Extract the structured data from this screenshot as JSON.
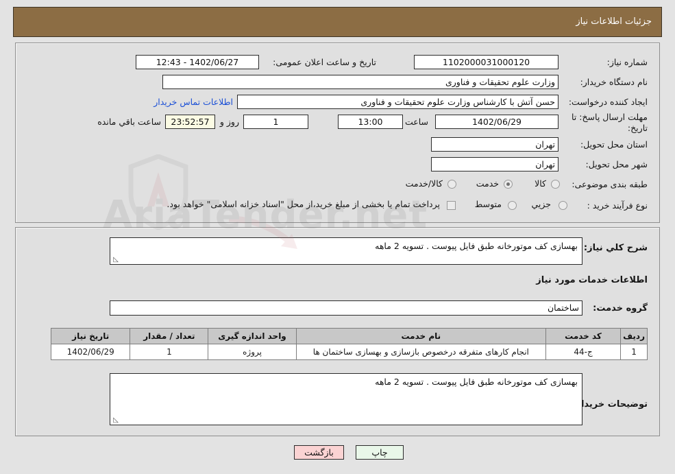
{
  "header": {
    "title": "جزئیات اطلاعات نیاز"
  },
  "watermark": {
    "text": "AriaTender.net"
  },
  "form": {
    "need_number_label": "شماره نیاز:",
    "need_number_value": "1102000031000120",
    "announce_datetime_label": "تاریخ و ساعت اعلان عمومی:",
    "announce_datetime_value": "1402/06/27 - 12:43",
    "buyer_org_label": "نام دستگاه خریدار:",
    "buyer_org_value": "وزارت علوم  تحقیقات و فناوری",
    "request_creator_label": "ایجاد کننده درخواست:",
    "request_creator_value": "حسن آتش با کارشناس وزارت علوم  تحقیقات و فناوری",
    "contact_link": "اطلاعات تماس خریدار",
    "deadline_label": "مهلت ارسال پاسخ: تا تاریخ:",
    "deadline_date": "1402/06/29",
    "time_label": "ساعت",
    "time_value": "13:00",
    "days_value": "1",
    "days_label": "روز و",
    "countdown_value": "23:52:57",
    "countdown_label": "ساعت باقي مانده",
    "province_label": "استان محل تحویل:",
    "province_value": "تهران",
    "city_label": "شهر محل تحویل:",
    "city_value": "تهران",
    "category_label": "طبقه بندی موضوعی:",
    "category_options": [
      "کالا",
      "خدمت",
      "کالا/خدمت"
    ],
    "category_selected": "خدمت",
    "process_label": "نوع فرآیند خرید :",
    "process_options": [
      "جزیي",
      "متوسط"
    ],
    "process_selected": "جزیي",
    "treasury_note": "پرداخت تمام یا بخشی از مبلغ خرید،از محل \"اسناد خزانه اسلامی\" خواهد بود.",
    "treasury_checked": false
  },
  "middle": {
    "general_desc_label": "شرح کلي نیاز:",
    "general_desc_value": "بهسازی کف موتورخانه طبق فایل پیوست . تسویه 2 ماهه",
    "services_heading": "اطلاعات خدمات مورد نیاز",
    "service_group_label": "گروه خدمت:",
    "service_group_value": "ساختمان",
    "buyer_notes_label": "توضیحات خریدار:",
    "buyer_notes_value": "بهسازی کف موتورخانه طبق فایل پیوست . تسویه 2 ماهه",
    "resize_grip": "◺"
  },
  "table": {
    "columns": [
      "ردیف",
      "کد خدمت",
      "نام خدمت",
      "واحد اندازه گیری",
      "تعداد / مقدار",
      "تاریخ نیاز"
    ],
    "rows": [
      {
        "row_no": "1",
        "service_code": "ج-44",
        "service_name": "انجام کارهای متفرقه درخصوص بازسازی و بهسازی ساختمان ها",
        "unit": "پروژه",
        "quantity": "1",
        "need_date": "1402/06/29"
      }
    ]
  },
  "buttons": {
    "print": "چاپ",
    "back": "بازگشت"
  }
}
